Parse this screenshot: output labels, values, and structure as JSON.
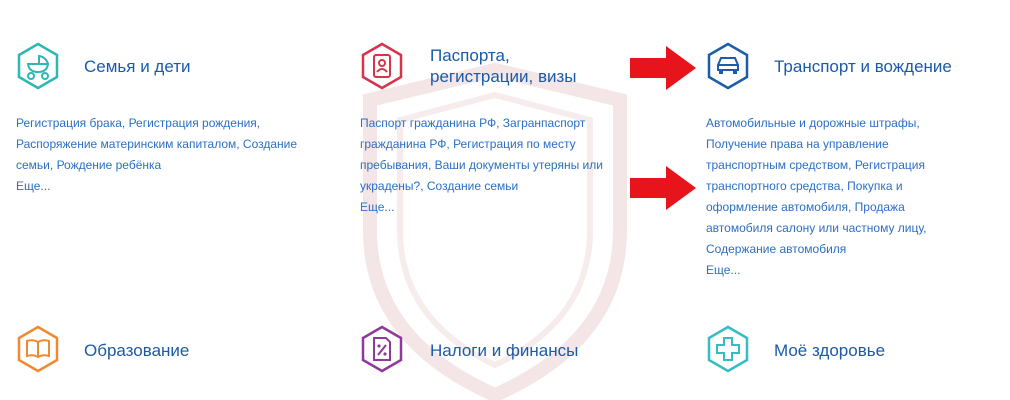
{
  "categories": [
    {
      "title": "Семья и дети",
      "icon": "baby-stroller-icon",
      "color": "#2fb7b3",
      "links": [
        "Регистрация брака",
        "Регистрация рождения",
        "Распоряжение материнским капиталом",
        "Создание семьи",
        "Рождение ребёнка"
      ],
      "more": "Еще..."
    },
    {
      "title_lines": [
        "Паспорта,",
        "регистрации, визы"
      ],
      "icon": "passport-icon",
      "color": "#d8334a",
      "links": [
        "Паспорт гражданина РФ",
        "Загранпаспорт гражданина РФ",
        "Регистрация по месту пребывания",
        "Ваши документы утеряны или украдены?",
        "Создание семьи"
      ],
      "more": "Еще..."
    },
    {
      "title": "Транспорт и вождение",
      "icon": "car-icon",
      "color": "#1b5da8",
      "links": [
        "Автомобильные и дорожные штрафы",
        "Получение права на управление транспортным средством",
        "Регистрация транспортного средства",
        "Покупка и оформление автомобиля",
        "Продажа автомобиля салону или частному лицу",
        "Содержание автомобиля"
      ],
      "more": "Еще..."
    },
    {
      "title": "Образование",
      "icon": "book-icon",
      "color": "#f08a32"
    },
    {
      "title": "Налоги и финансы",
      "icon": "tax-document-icon",
      "color": "#8e3a9a"
    },
    {
      "title": "Моё здоровье",
      "icon": "medical-cross-icon",
      "color": "#37bcc3"
    }
  ],
  "arrows": {
    "color": "#e8141b",
    "icon": "red-arrow-right-icon"
  }
}
